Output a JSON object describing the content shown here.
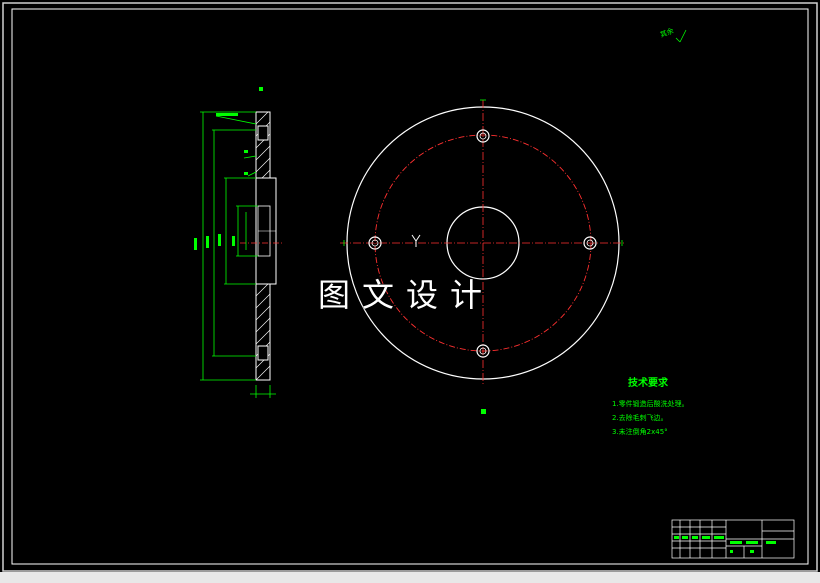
{
  "watermark": "图文设计",
  "technical_requirements": {
    "title": "技术要求",
    "items": [
      "1.零件锻造后酸洗处理。",
      "2.去除毛刺飞边。",
      "3.未注倒角2x45°"
    ]
  },
  "corner_note": "其余",
  "colors": {
    "background": "#000000",
    "frame": "#ffffff",
    "dimension": "#00ff00",
    "centerline": "#ff0000",
    "outline": "#ffffff"
  }
}
